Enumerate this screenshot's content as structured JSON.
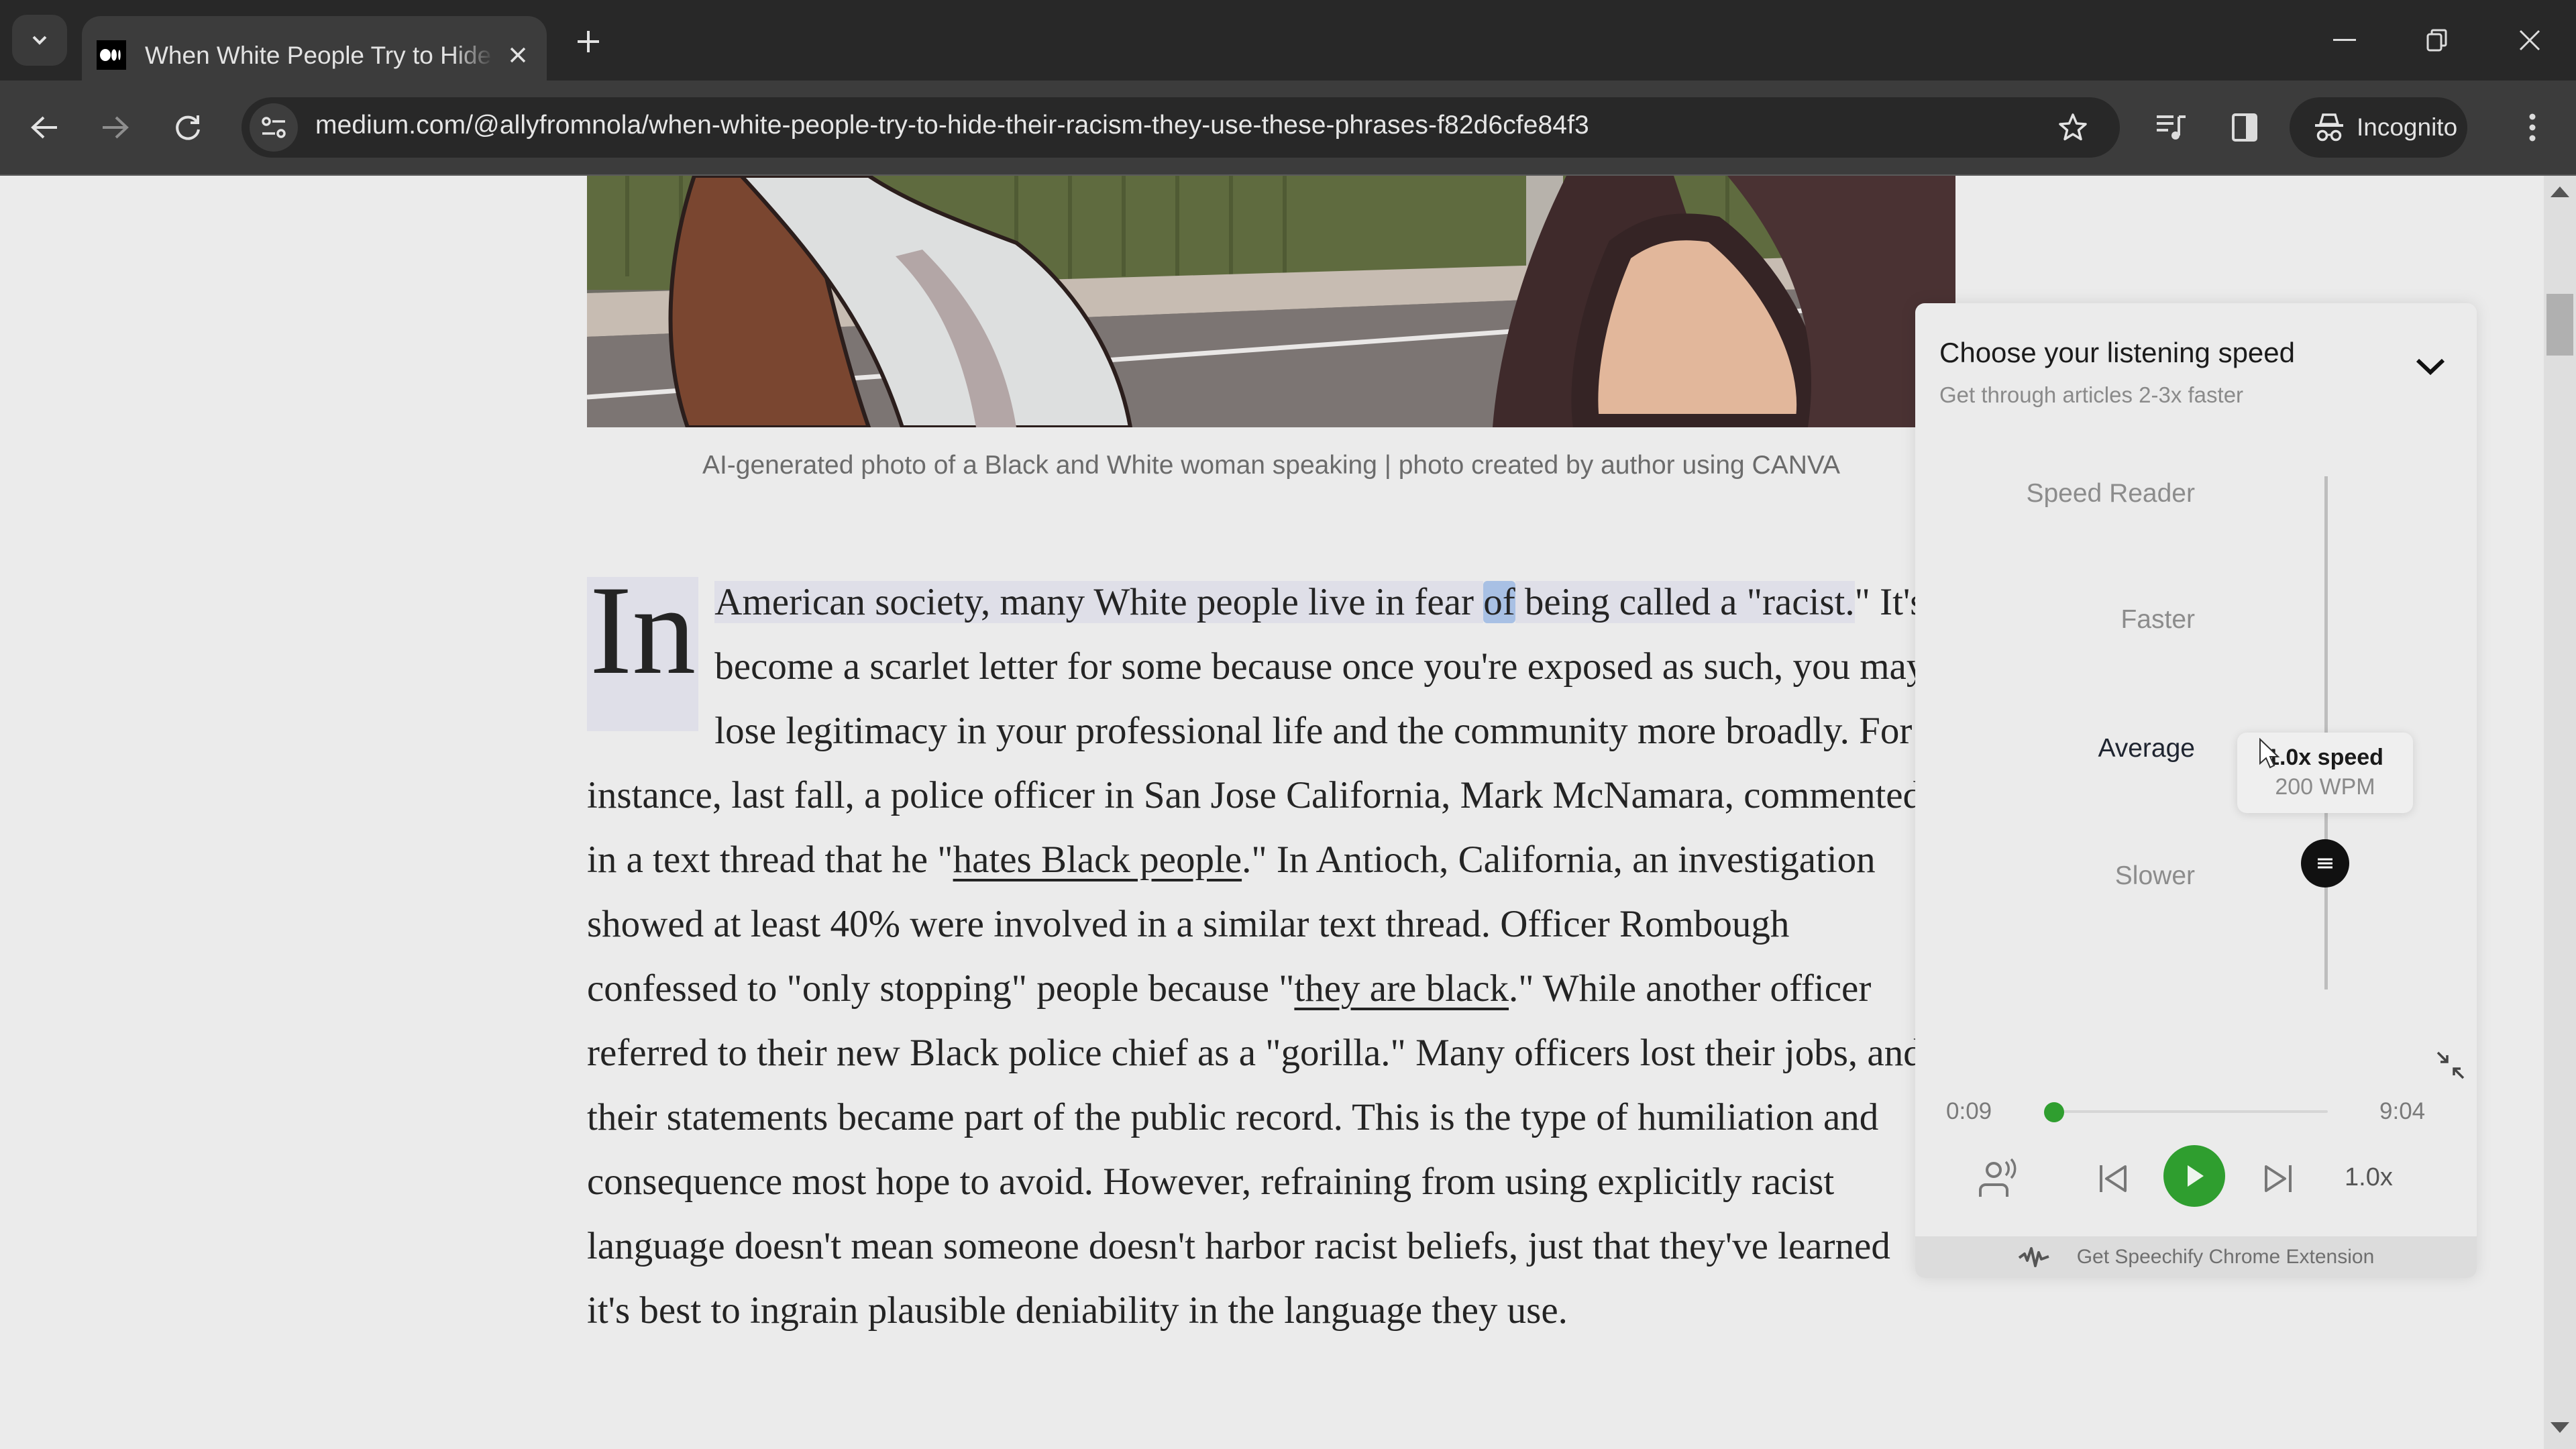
{
  "browser": {
    "tab": {
      "title": "When White People Try to Hide Their Racism",
      "favicon": "medium-logo-icon"
    },
    "window_controls": [
      "minimize",
      "restore",
      "close"
    ],
    "url": "medium.com/@allyfromnola/when-white-people-try-to-hide-their-racism-they-use-these-phrases-f82d6cfe84f3",
    "profile_label": "Incognito"
  },
  "article": {
    "caption": "AI-generated photo of a Black and White woman speaking | photo created by author using CANVA",
    "dropcap": "In",
    "seg1_hl": " American society, many White people live in fear ",
    "seg1_word": "of",
    "seg1_hl2": " being called a ",
    "seg2_hl": "\"racist.",
    "seg3": "\" It's become a scarlet letter for some because once you're exposed as such, you may lose legitimacy in your professional life and the community more broadly. For instance, last fall, a police officer in San Jose California, Mark McNamara, commented in a text thread that he \"",
    "link1": "hates Black people",
    "seg4": ".\" In Antioch, California, an investigation showed at least 40% were involved in a similar text thread. Officer Rombough confessed to \"only stopping\" people because \"",
    "link2": "they are black",
    "seg5": ".\" While another officer referred to their new Black police chief as a \"gorilla.\" Many officers lost their jobs, and their statements became part of the public record. This is the type of humiliation and consequence most hope to avoid. However, refraining from using explicitly racist language doesn't mean someone doesn't harbor racist beliefs, just that they've learned it's best to ingrain plausible deniability in the language they use."
  },
  "speechify": {
    "title": "Choose your listening speed",
    "subtitle": "Get through articles 2-3x faster",
    "speed_levels": [
      "Speed Reader",
      "Faster",
      "Average",
      "Slower"
    ],
    "selected_level": "Average",
    "tooltip_speed": "1.0x speed",
    "tooltip_wpm": "200 WPM",
    "time_current": "0:09",
    "time_total": "9:04",
    "progress_fraction": 0.017,
    "speed_button": "1.0x",
    "footer_label": "Get Speechify Chrome Extension",
    "accent_color": "#2f9e2f"
  }
}
